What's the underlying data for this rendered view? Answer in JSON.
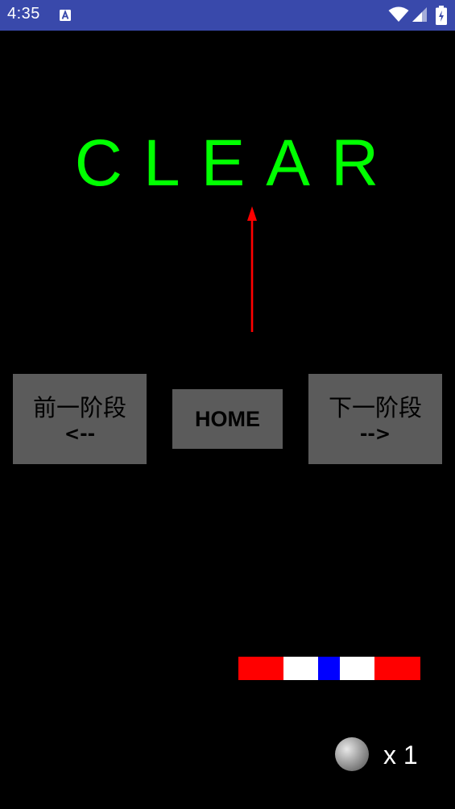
{
  "status_bar": {
    "time": "4:35",
    "background_color": "#3949ab",
    "icons": [
      "text-notification-icon",
      "wifi-icon",
      "signal-icon",
      "battery-icon"
    ]
  },
  "game": {
    "title": "CLEAR",
    "title_color": "#00ff00",
    "arrow_color": "#ff0000",
    "buttons": {
      "prev": {
        "line1": "前一阶段",
        "line2": "<--"
      },
      "home": {
        "label": "HOME"
      },
      "next": {
        "line1": "下一阶段",
        "line2": "-->"
      }
    },
    "button_color": "#5b5b5b",
    "paddle": {
      "segments": [
        {
          "color": "#ff0000"
        },
        {
          "color": "#ffffff"
        },
        {
          "color": "#0000ff"
        },
        {
          "color": "#ffffff"
        },
        {
          "color": "#ff0000"
        }
      ]
    },
    "lives": {
      "icon": "ball-icon",
      "label": "x 1"
    }
  }
}
